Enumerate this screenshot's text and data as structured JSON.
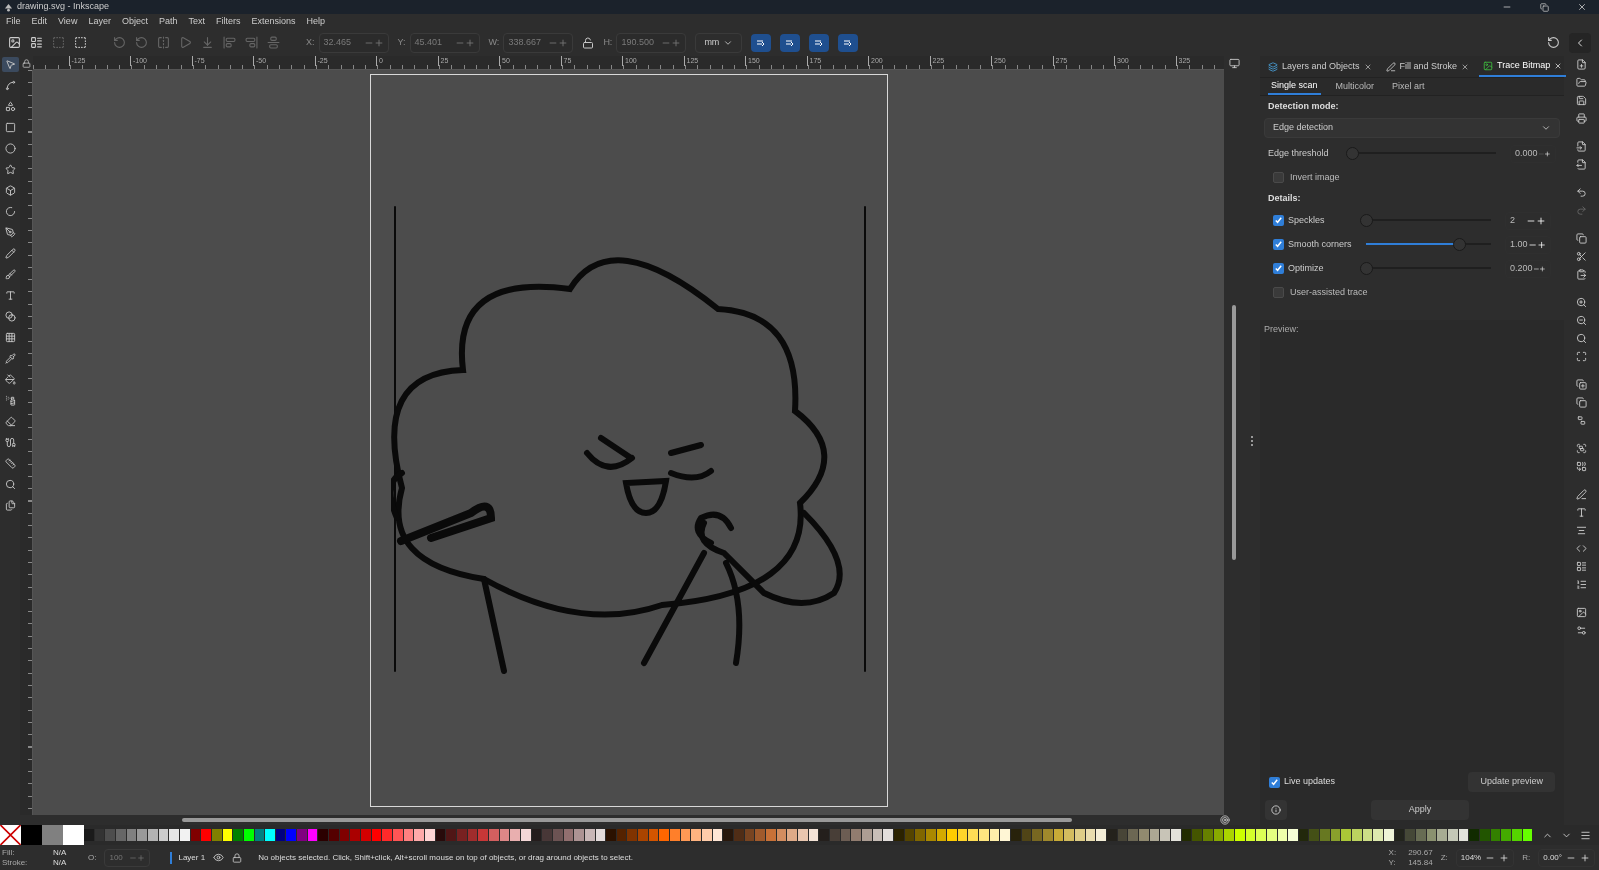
{
  "window": {
    "title": "drawing.svg - Inkscape"
  },
  "menu": [
    "File",
    "Edit",
    "View",
    "Layer",
    "Object",
    "Path",
    "Text",
    "Filters",
    "Extensions",
    "Help"
  ],
  "toolbar": {
    "fields": [
      {
        "label": "X:",
        "value": "32.465"
      },
      {
        "label": "Y:",
        "value": "45.401"
      },
      {
        "label": "W:",
        "value": "338.667"
      },
      {
        "label": "H:",
        "value": "190.500"
      }
    ],
    "unit": "mm"
  },
  "ruler": {
    "labels": [
      "-125",
      "-100",
      "-75",
      "-50",
      "-25",
      "0",
      "25",
      "50",
      "75",
      "100",
      "125",
      "150",
      "175",
      "200",
      "225",
      "250",
      "275",
      "300",
      "325"
    ]
  },
  "panel": {
    "tabs": [
      {
        "label": "Layers and Objects",
        "selected": false
      },
      {
        "label": "Fill and Stroke",
        "selected": false
      },
      {
        "label": "Trace Bitmap",
        "selected": true
      }
    ],
    "subtabs": [
      {
        "label": "Single scan",
        "selected": true
      },
      {
        "label": "Multicolor",
        "selected": false
      },
      {
        "label": "Pixel art",
        "selected": false
      }
    ],
    "detection_label": "Detection mode:",
    "detection_value": "Edge detection",
    "rows": [
      {
        "kind": "slider",
        "label": "Edge threshold",
        "level": 0,
        "value": "0.000"
      },
      {
        "kind": "check",
        "label": "Invert image",
        "checked": false
      },
      {
        "kind": "heading",
        "label": "Details:"
      },
      {
        "kind": "check_slider",
        "label": "Speckles",
        "checked": true,
        "level": 0,
        "value": "2"
      },
      {
        "kind": "check_slider",
        "label": "Smooth corners",
        "checked": true,
        "level": 0.75,
        "value": "1.00"
      },
      {
        "kind": "check_slider",
        "label": "Optimize",
        "checked": true,
        "level": 0,
        "value": "0.200"
      },
      {
        "kind": "check",
        "label": "User-assisted trace",
        "checked": false
      }
    ],
    "preview_label": "Preview:",
    "live_updates": {
      "label": "Live updates",
      "checked": true
    },
    "update_button": "Update preview",
    "apply_button": "Apply"
  },
  "palette": [
    {
      "color": "#000000"
    },
    {
      "color": "#808080"
    },
    {
      "color": "#ffffff"
    }
  ],
  "swatches": [
    {
      "color": "#1a1a1a"
    },
    {
      "color": "#333333"
    },
    {
      "color": "#4d4d4d"
    },
    {
      "color": "#666666"
    },
    {
      "color": "#808080"
    },
    {
      "color": "#999999"
    },
    {
      "color": "#b3b3b3"
    },
    {
      "color": "#cccccc"
    },
    {
      "color": "#e6e6e6"
    },
    {
      "color": "#f2f2f2"
    },
    {
      "color": "#800000"
    },
    {
      "color": "#ff0000"
    },
    {
      "color": "#808000"
    },
    {
      "color": "#ffff00"
    },
    {
      "color": "#008000"
    },
    {
      "color": "#00ff00"
    },
    {
      "color": "#008080"
    },
    {
      "color": "#00ffff"
    },
    {
      "color": "#000080"
    },
    {
      "color": "#0000ff"
    },
    {
      "color": "#800080"
    },
    {
      "color": "#ff00ff"
    },
    {
      "color": "#2b0000"
    },
    {
      "color": "#550000"
    },
    {
      "color": "#800000"
    },
    {
      "color": "#aa0000"
    },
    {
      "color": "#d40000"
    },
    {
      "color": "#ff0000"
    },
    {
      "color": "#ff2a2a"
    },
    {
      "color": "#ff5555"
    },
    {
      "color": "#ff8080"
    },
    {
      "color": "#ffaaaa"
    },
    {
      "color": "#ffd5d5"
    },
    {
      "color": "#280b0b"
    },
    {
      "color": "#501616"
    },
    {
      "color": "#782121"
    },
    {
      "color": "#a02c2c"
    },
    {
      "color": "#c83737"
    },
    {
      "color": "#d35f5f"
    },
    {
      "color": "#de8787"
    },
    {
      "color": "#e9afaf"
    },
    {
      "color": "#f4d7d7"
    },
    {
      "color": "#241c1c"
    },
    {
      "color": "#483737"
    },
    {
      "color": "#6c5353"
    },
    {
      "color": "#916f6f"
    },
    {
      "color": "#ac9393"
    },
    {
      "color": "#c8b7b7"
    },
    {
      "color": "#e3dbdb"
    },
    {
      "color": "#2b1100"
    },
    {
      "color": "#552200"
    },
    {
      "color": "#803300"
    },
    {
      "color": "#aa4400"
    },
    {
      "color": "#d45500"
    },
    {
      "color": "#ff6600"
    },
    {
      "color": "#ff7f2a"
    },
    {
      "color": "#ff9955"
    },
    {
      "color": "#ffb380"
    },
    {
      "color": "#ffccaa"
    },
    {
      "color": "#ffe6d5"
    },
    {
      "color": "#28170b"
    },
    {
      "color": "#502d16"
    },
    {
      "color": "#784421"
    },
    {
      "color": "#a05a2c"
    },
    {
      "color": "#c87137"
    },
    {
      "color": "#d38d5f"
    },
    {
      "color": "#deaa87"
    },
    {
      "color": "#e9c6af"
    },
    {
      "color": "#f4e3d7"
    },
    {
      "color": "#241f1c"
    },
    {
      "color": "#483e37"
    },
    {
      "color": "#6c5d53"
    },
    {
      "color": "#917c6f"
    },
    {
      "color": "#ac9d93"
    },
    {
      "color": "#c8beb7"
    },
    {
      "color": "#e3dedb"
    },
    {
      "color": "#2b2200"
    },
    {
      "color": "#554400"
    },
    {
      "color": "#806600"
    },
    {
      "color": "#aa8800"
    },
    {
      "color": "#d4aa00"
    },
    {
      "color": "#ffcc00"
    },
    {
      "color": "#ffd42a"
    },
    {
      "color": "#ffdd55"
    },
    {
      "color": "#ffe680"
    },
    {
      "color": "#ffeeaa"
    },
    {
      "color": "#fff6d5"
    },
    {
      "color": "#28220b"
    },
    {
      "color": "#504416"
    },
    {
      "color": "#786721"
    },
    {
      "color": "#a0892c"
    },
    {
      "color": "#c8ab37"
    },
    {
      "color": "#d3bc5f"
    },
    {
      "color": "#decd87"
    },
    {
      "color": "#e9ddaf"
    },
    {
      "color": "#f4eed7"
    },
    {
      "color": "#24221c"
    },
    {
      "color": "#484537"
    },
    {
      "color": "#6c6753"
    },
    {
      "color": "#918a6f"
    },
    {
      "color": "#aca793"
    },
    {
      "color": "#c8c4b7"
    },
    {
      "color": "#e3e2db"
    },
    {
      "color": "#222b00"
    },
    {
      "color": "#445500"
    },
    {
      "color": "#668000"
    },
    {
      "color": "#88aa00"
    },
    {
      "color": "#aad400"
    },
    {
      "color": "#ccff00"
    },
    {
      "color": "#d4ff2a"
    },
    {
      "color": "#ddff55"
    },
    {
      "color": "#e5ff80"
    },
    {
      "color": "#eeffaa"
    },
    {
      "color": "#f6ffd5"
    },
    {
      "color": "#22280b"
    },
    {
      "color": "#445016"
    },
    {
      "color": "#677821"
    },
    {
      "color": "#89a02c"
    },
    {
      "color": "#abc837"
    },
    {
      "color": "#bcd35f"
    },
    {
      "color": "#cdde87"
    },
    {
      "color": "#dde9af"
    },
    {
      "color": "#eef4d7"
    },
    {
      "color": "#22241c"
    },
    {
      "color": "#454837"
    },
    {
      "color": "#676c53"
    },
    {
      "color": "#8a916f"
    },
    {
      "color": "#a7ac93"
    },
    {
      "color": "#c4c8b7"
    },
    {
      "color": "#e2e3db"
    },
    {
      "color": "#112b00"
    },
    {
      "color": "#225500"
    },
    {
      "color": "#338000"
    },
    {
      "color": "#44aa00"
    },
    {
      "color": "#55d400"
    },
    {
      "color": "#66ff00"
    }
  ],
  "status": {
    "fill_label": "Fill:",
    "fill_value": "N/A",
    "stroke_label": "Stroke:",
    "stroke_value": "N/A",
    "opacity_label": "O:",
    "opacity_value": "100",
    "layer": "Layer 1",
    "message": "No objects selected. Click, Shift+click, Alt+scroll mouse on top of objects, or drag around objects to select.",
    "x_label": "X:",
    "x_value": "290.67",
    "y_label": "Y:",
    "y_value": "145.84",
    "zoom_label": "Z:",
    "zoom_value": "104%",
    "rotate_label": "R:",
    "rotate_value": "0.00°"
  }
}
